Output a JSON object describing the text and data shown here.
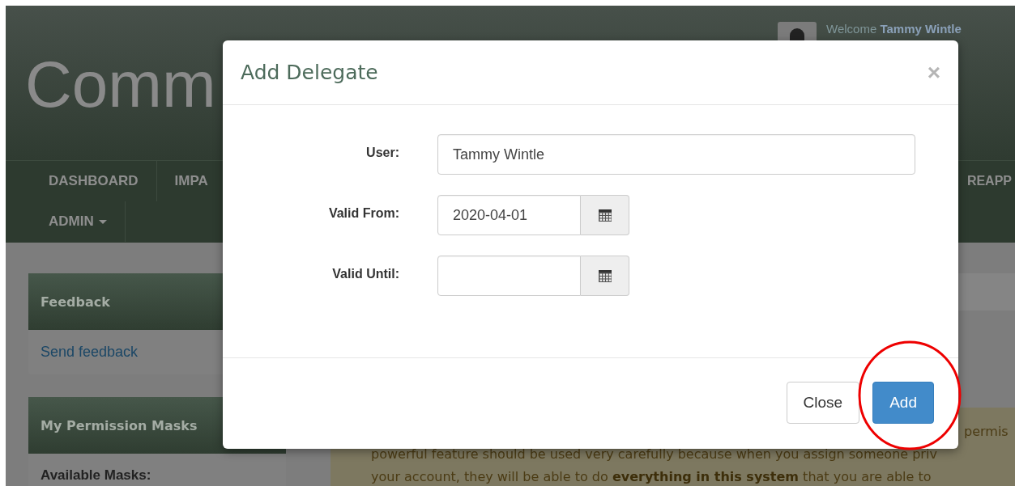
{
  "header": {
    "title": "Comm",
    "welcome": {
      "greeting": "Welcome",
      "user": "Tammy Wintle"
    }
  },
  "nav": {
    "rows": [
      [
        {
          "label": "DASHBOARD",
          "dropdown": false
        },
        {
          "label": "IMPA",
          "dropdown": false
        },
        {
          "label": "REAPP",
          "dropdown": false
        }
      ],
      [
        {
          "label": "ADMIN",
          "dropdown": true
        }
      ]
    ]
  },
  "sidebar": {
    "panels": [
      {
        "title": "Feedback",
        "items": [
          {
            "kind": "link",
            "text": "Send feedback"
          }
        ]
      },
      {
        "title": "My Permission Masks",
        "items": [
          {
            "kind": "label",
            "text": "Available Masks:"
          }
        ]
      }
    ]
  },
  "alert": {
    "lines": [
      "permis",
      "powerful feature should be used very carefully because when you assign someone priv",
      "your account, they will be able to do **everything in this system** that you are able to"
    ]
  },
  "modal": {
    "title": "Add Delegate",
    "close": "×",
    "fields": [
      {
        "label": "User:",
        "kind": "text",
        "value": "Tammy Wintle"
      },
      {
        "label": "Valid From:",
        "kind": "date",
        "value": "2020-04-01"
      },
      {
        "label": "Valid Until:",
        "kind": "date"
      }
    ],
    "buttons": [
      {
        "label": "Close",
        "primary": false,
        "highlighted": false
      },
      {
        "label": "Add",
        "primary": true,
        "highlighted": true
      }
    ]
  }
}
